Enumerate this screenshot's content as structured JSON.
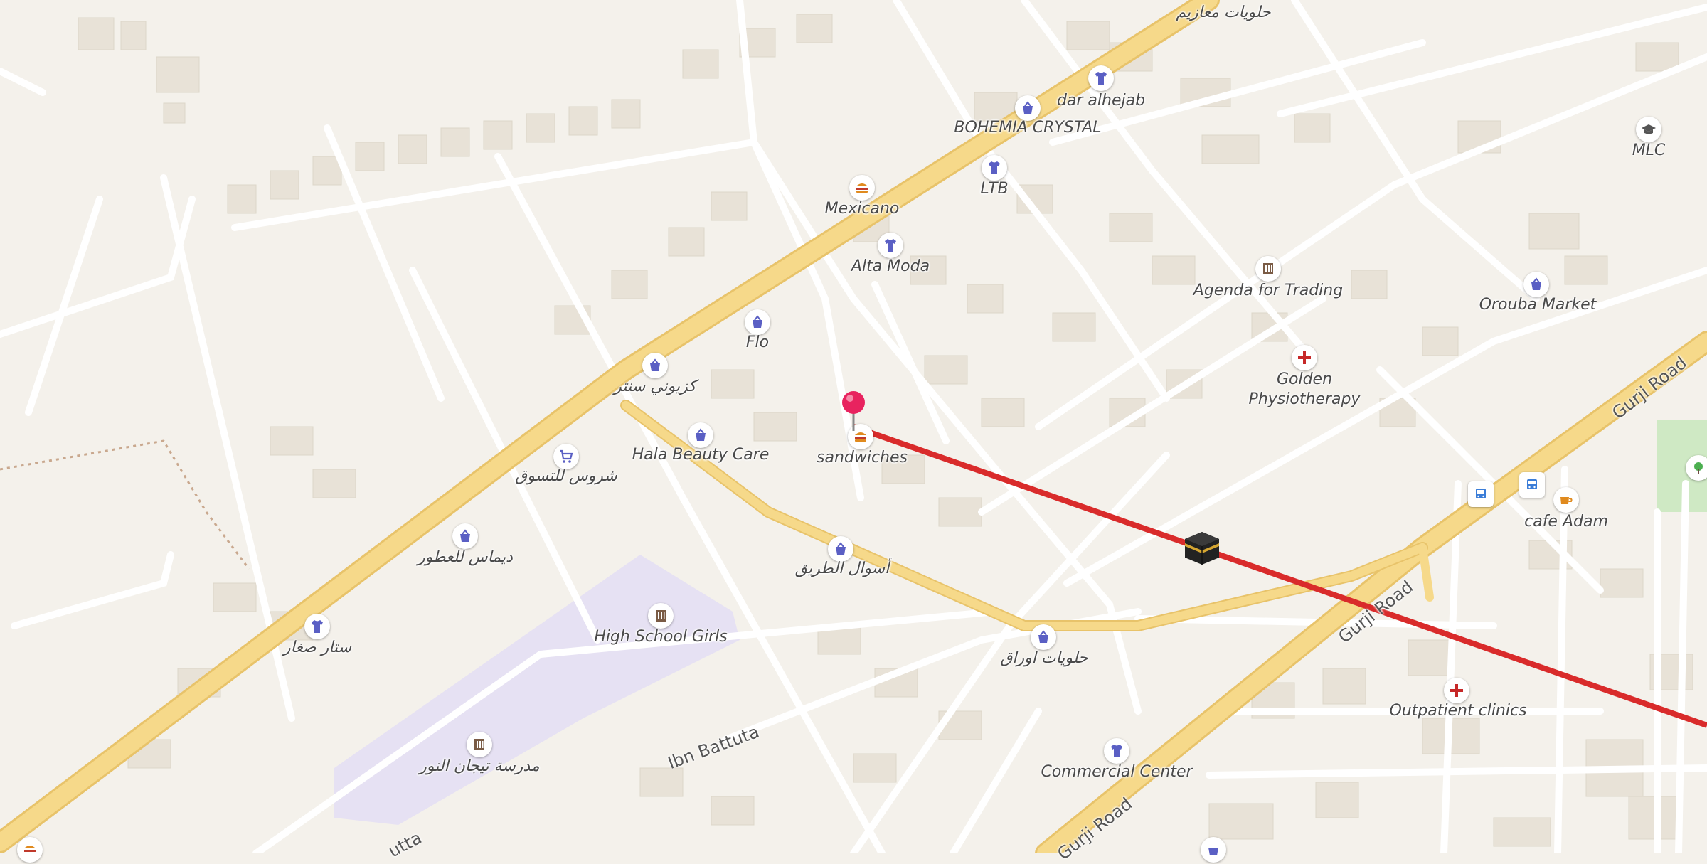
{
  "map": {
    "background": "#f4f1eb",
    "building_color": "#e9e3d8",
    "major_road_color": "#f6d98a",
    "minor_road_color": "#ffffff",
    "route_color": "#d92b2b",
    "school_area_color": "#e6e1f3",
    "park_color": "#cfe9c4"
  },
  "roads": {
    "gurji_1": "Gurji Road",
    "gurji_2": "Gurji Road",
    "gurji_3": "Gurji Road",
    "ibn_battuta": "Ibn Battuta",
    "ibn_battuta_partial": "utta"
  },
  "pois": {
    "halawiyat_maazim": {
      "label": "حلويات معازيم",
      "icon": "none"
    },
    "dar_alhejab": {
      "label": "dar alhejab",
      "icon": "shirt-icon"
    },
    "bohemia_crystal": {
      "label": "BOHEMIA CRYSTAL",
      "icon": "shopping-bag-icon"
    },
    "ltb": {
      "label": "LTB",
      "icon": "shirt-icon"
    },
    "mexicano": {
      "label": "Mexicano",
      "icon": "burger-icon"
    },
    "alta_moda": {
      "label": "Alta Moda",
      "icon": "shirt-icon"
    },
    "flo": {
      "label": "Flo",
      "icon": "shopping-bag-icon"
    },
    "kidz_center": {
      "label": "كزيوني سنتر",
      "icon": "shopping-bag-icon"
    },
    "hala_beauty": {
      "label": "Hala Beauty Care",
      "icon": "shopping-bag-icon"
    },
    "sandwiches": {
      "label": "sandwiches",
      "icon": "burger-icon"
    },
    "shorouq": {
      "label": "شروس للتسوق",
      "icon": "shopping-cart-icon"
    },
    "dimas": {
      "label": "ديماس للعطور",
      "icon": "shopping-bag-icon"
    },
    "asal_tareeq": {
      "label": "أسوال الطريق",
      "icon": "shopping-bag-icon"
    },
    "star_sighar": {
      "label": "ستار صغار",
      "icon": "shirt-icon"
    },
    "high_school": {
      "label": "High School Girls",
      "icon": "school-icon"
    },
    "taj_school": {
      "label": "مدرسة تيجان النور",
      "icon": "school-icon"
    },
    "halawiyat_awraq": {
      "label": "حلويات اوراق",
      "icon": "shopping-bag-icon"
    },
    "agenda_trading": {
      "label": "Agenda for Trading",
      "icon": "school-icon"
    },
    "mlc": {
      "label": "MLC",
      "icon": "graduation-cap-icon"
    },
    "orouba_market": {
      "label": "Orouba Market",
      "icon": "shopping-bag-icon"
    },
    "golden_physio": {
      "label": "Golden\nPhysiotherapy",
      "icon": "medical-cross-icon"
    },
    "cafe_adam": {
      "label": "cafe Adam",
      "icon": "coffee-icon"
    },
    "outpatient": {
      "label": "Outpatient clinics",
      "icon": "medical-cross-icon"
    },
    "commercial_center": {
      "label": "Commercial Center",
      "icon": "shirt-icon"
    }
  }
}
